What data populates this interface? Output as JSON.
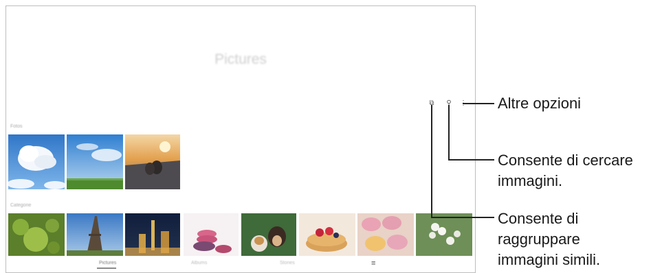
{
  "app": {
    "title": "Pictures",
    "sections": [
      {
        "label": "Fotos"
      },
      {
        "label": "Categorie"
      }
    ]
  },
  "toolbar": {
    "group_icon": "⧉",
    "search_icon": "⚲",
    "more_icon": "⋮"
  },
  "bottom_nav": {
    "tabs": [
      {
        "label": "Pictures"
      },
      {
        "label": "Albums"
      },
      {
        "label": "Stories"
      }
    ],
    "menu_icon": "≡"
  },
  "callouts": {
    "more_options": "Altre opzioni",
    "search": [
      "Consente di cercare",
      "immagini."
    ],
    "group": [
      "Consente di",
      "raggruppare",
      "immagini simili."
    ]
  },
  "colors": {
    "sky_blue": "#4b8fd6",
    "grass_green": "#4e8a2e",
    "sunset_orange": "#e3a14e",
    "macaron_pink": "#e9a3b4"
  }
}
